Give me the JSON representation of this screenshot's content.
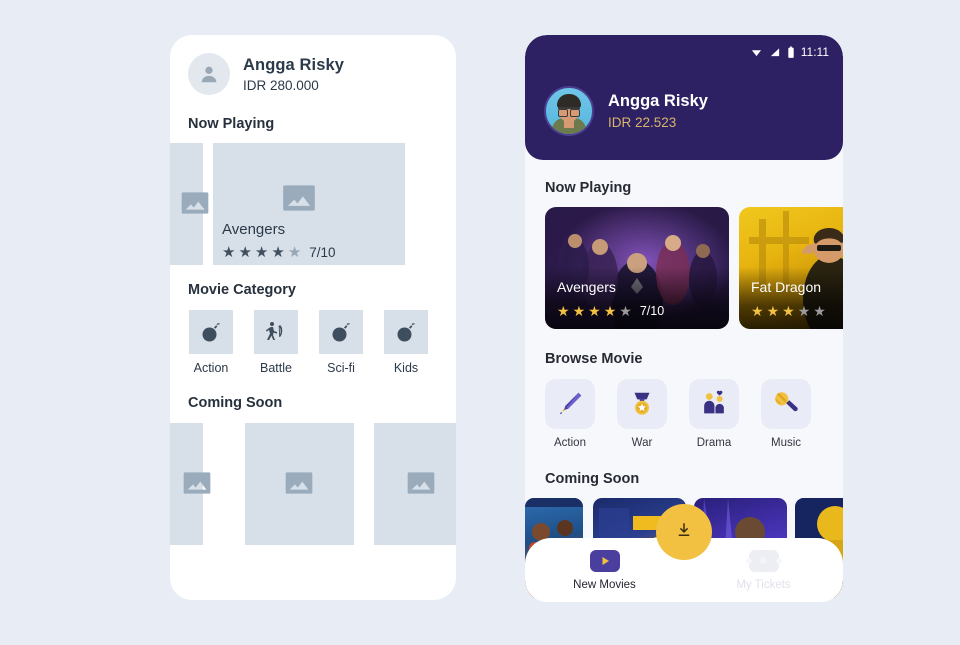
{
  "theme": {
    "page_background": "#e7ecf5",
    "header_purple": "#2d2163",
    "accent_gold": "#f2c141",
    "balance_gold": "#d9b46a",
    "nav_active_purple": "#4a3f9e",
    "wire_card_gray": "#d7dfe9"
  },
  "wireframe_phone": {
    "profile": {
      "avatar_icon": "person-icon",
      "name": "Angga Risky",
      "balance": "IDR 280.000"
    },
    "sections": {
      "now_playing": "Now Playing",
      "movie_category": "Movie Category",
      "coming_soon": "Coming Soon"
    },
    "now_playing_card": {
      "placeholder_icon": "image-placeholder-icon",
      "title": "Avengers",
      "stars_filled": 4,
      "stars_total": 5,
      "score": "7/10"
    },
    "categories": [
      {
        "label": "Action",
        "icon": "bomb-icon"
      },
      {
        "label": "Battle",
        "icon": "archer-icon"
      },
      {
        "label": "Sci-fi",
        "icon": "bomb-icon"
      },
      {
        "label": "Kids",
        "icon": "bomb-icon"
      }
    ],
    "coming_soon_cards": [
      {
        "placeholder_icon": "image-placeholder-icon"
      },
      {
        "placeholder_icon": "image-placeholder-icon"
      },
      {
        "placeholder_icon": "image-placeholder-icon"
      }
    ]
  },
  "hifi_phone": {
    "status_bar": {
      "wifi_icon": "wifi-icon",
      "signal_icon": "signal-icon",
      "battery_icon": "battery-icon",
      "time": "11:11"
    },
    "profile": {
      "avatar_icon": "user-photo-avatar",
      "name": "Angga Risky",
      "balance": "IDR 22.523"
    },
    "sections": {
      "now_playing": "Now Playing",
      "browse_movie": "Browse Movie",
      "coming_soon": "Coming Soon"
    },
    "now_playing": [
      {
        "title": "Avengers",
        "stars_filled": 4,
        "stars_total": 5,
        "score": "7/10"
      },
      {
        "title": "Fat Dragon",
        "stars_filled": 3,
        "stars_total": 5,
        "score": ""
      }
    ],
    "browse_categories": [
      {
        "label": "Action",
        "icon": "sword-icon"
      },
      {
        "label": "War",
        "icon": "medal-icon"
      },
      {
        "label": "Drama",
        "icon": "couple-heart-icon"
      },
      {
        "label": "Music",
        "icon": "microphone-icon"
      }
    ],
    "coming_soon_posters": [
      {
        "name": "poster-1"
      },
      {
        "name": "poster-2"
      },
      {
        "name": "poster-3"
      },
      {
        "name": "poster-4"
      }
    ],
    "fab": {
      "icon": "download-icon"
    },
    "bottom_nav": [
      {
        "label": "New Movies",
        "icon": "play-icon",
        "active": true
      },
      {
        "label": "My Tickets",
        "icon": "ticket-icon",
        "active": false
      }
    ]
  }
}
